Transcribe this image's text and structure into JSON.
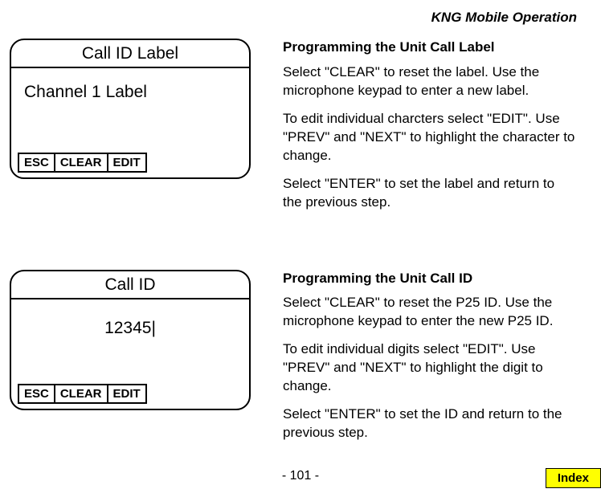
{
  "header": "KNG Mobile Operation",
  "sections": [
    {
      "panel": {
        "title": "Call ID Label",
        "content": "Channel 1 Label",
        "content_center": false,
        "softkeys": [
          "ESC",
          "CLEAR",
          "EDIT"
        ]
      },
      "instructions": {
        "title": "Programming the Unit Call Label",
        "paragraphs": [
          "Select \"CLEAR\" to reset the label. Use the microphone keypad to enter a new label.",
          "To edit individual charcters select \"EDIT\". Use \"PREV\" and \"NEXT\" to highlight the character to change.",
          "Select \"ENTER\" to set the label and return to the previous step."
        ]
      }
    },
    {
      "panel": {
        "title": "Call ID",
        "content": "12345|",
        "content_center": true,
        "softkeys": [
          "ESC",
          "CLEAR",
          "EDIT"
        ]
      },
      "instructions": {
        "title": "Programming the Unit Call ID",
        "paragraphs": [
          "Select \"CLEAR\" to reset the P25 ID. Use the microphone keypad to enter the new P25 ID.",
          "To edit individual digits select \"EDIT\". Use \"PREV\" and \"NEXT\" to highlight the digit to change.",
          "Select \"ENTER\" to set the ID and return to the previous step."
        ]
      }
    }
  ],
  "page_number": "- 101 -",
  "index_label": "Index"
}
